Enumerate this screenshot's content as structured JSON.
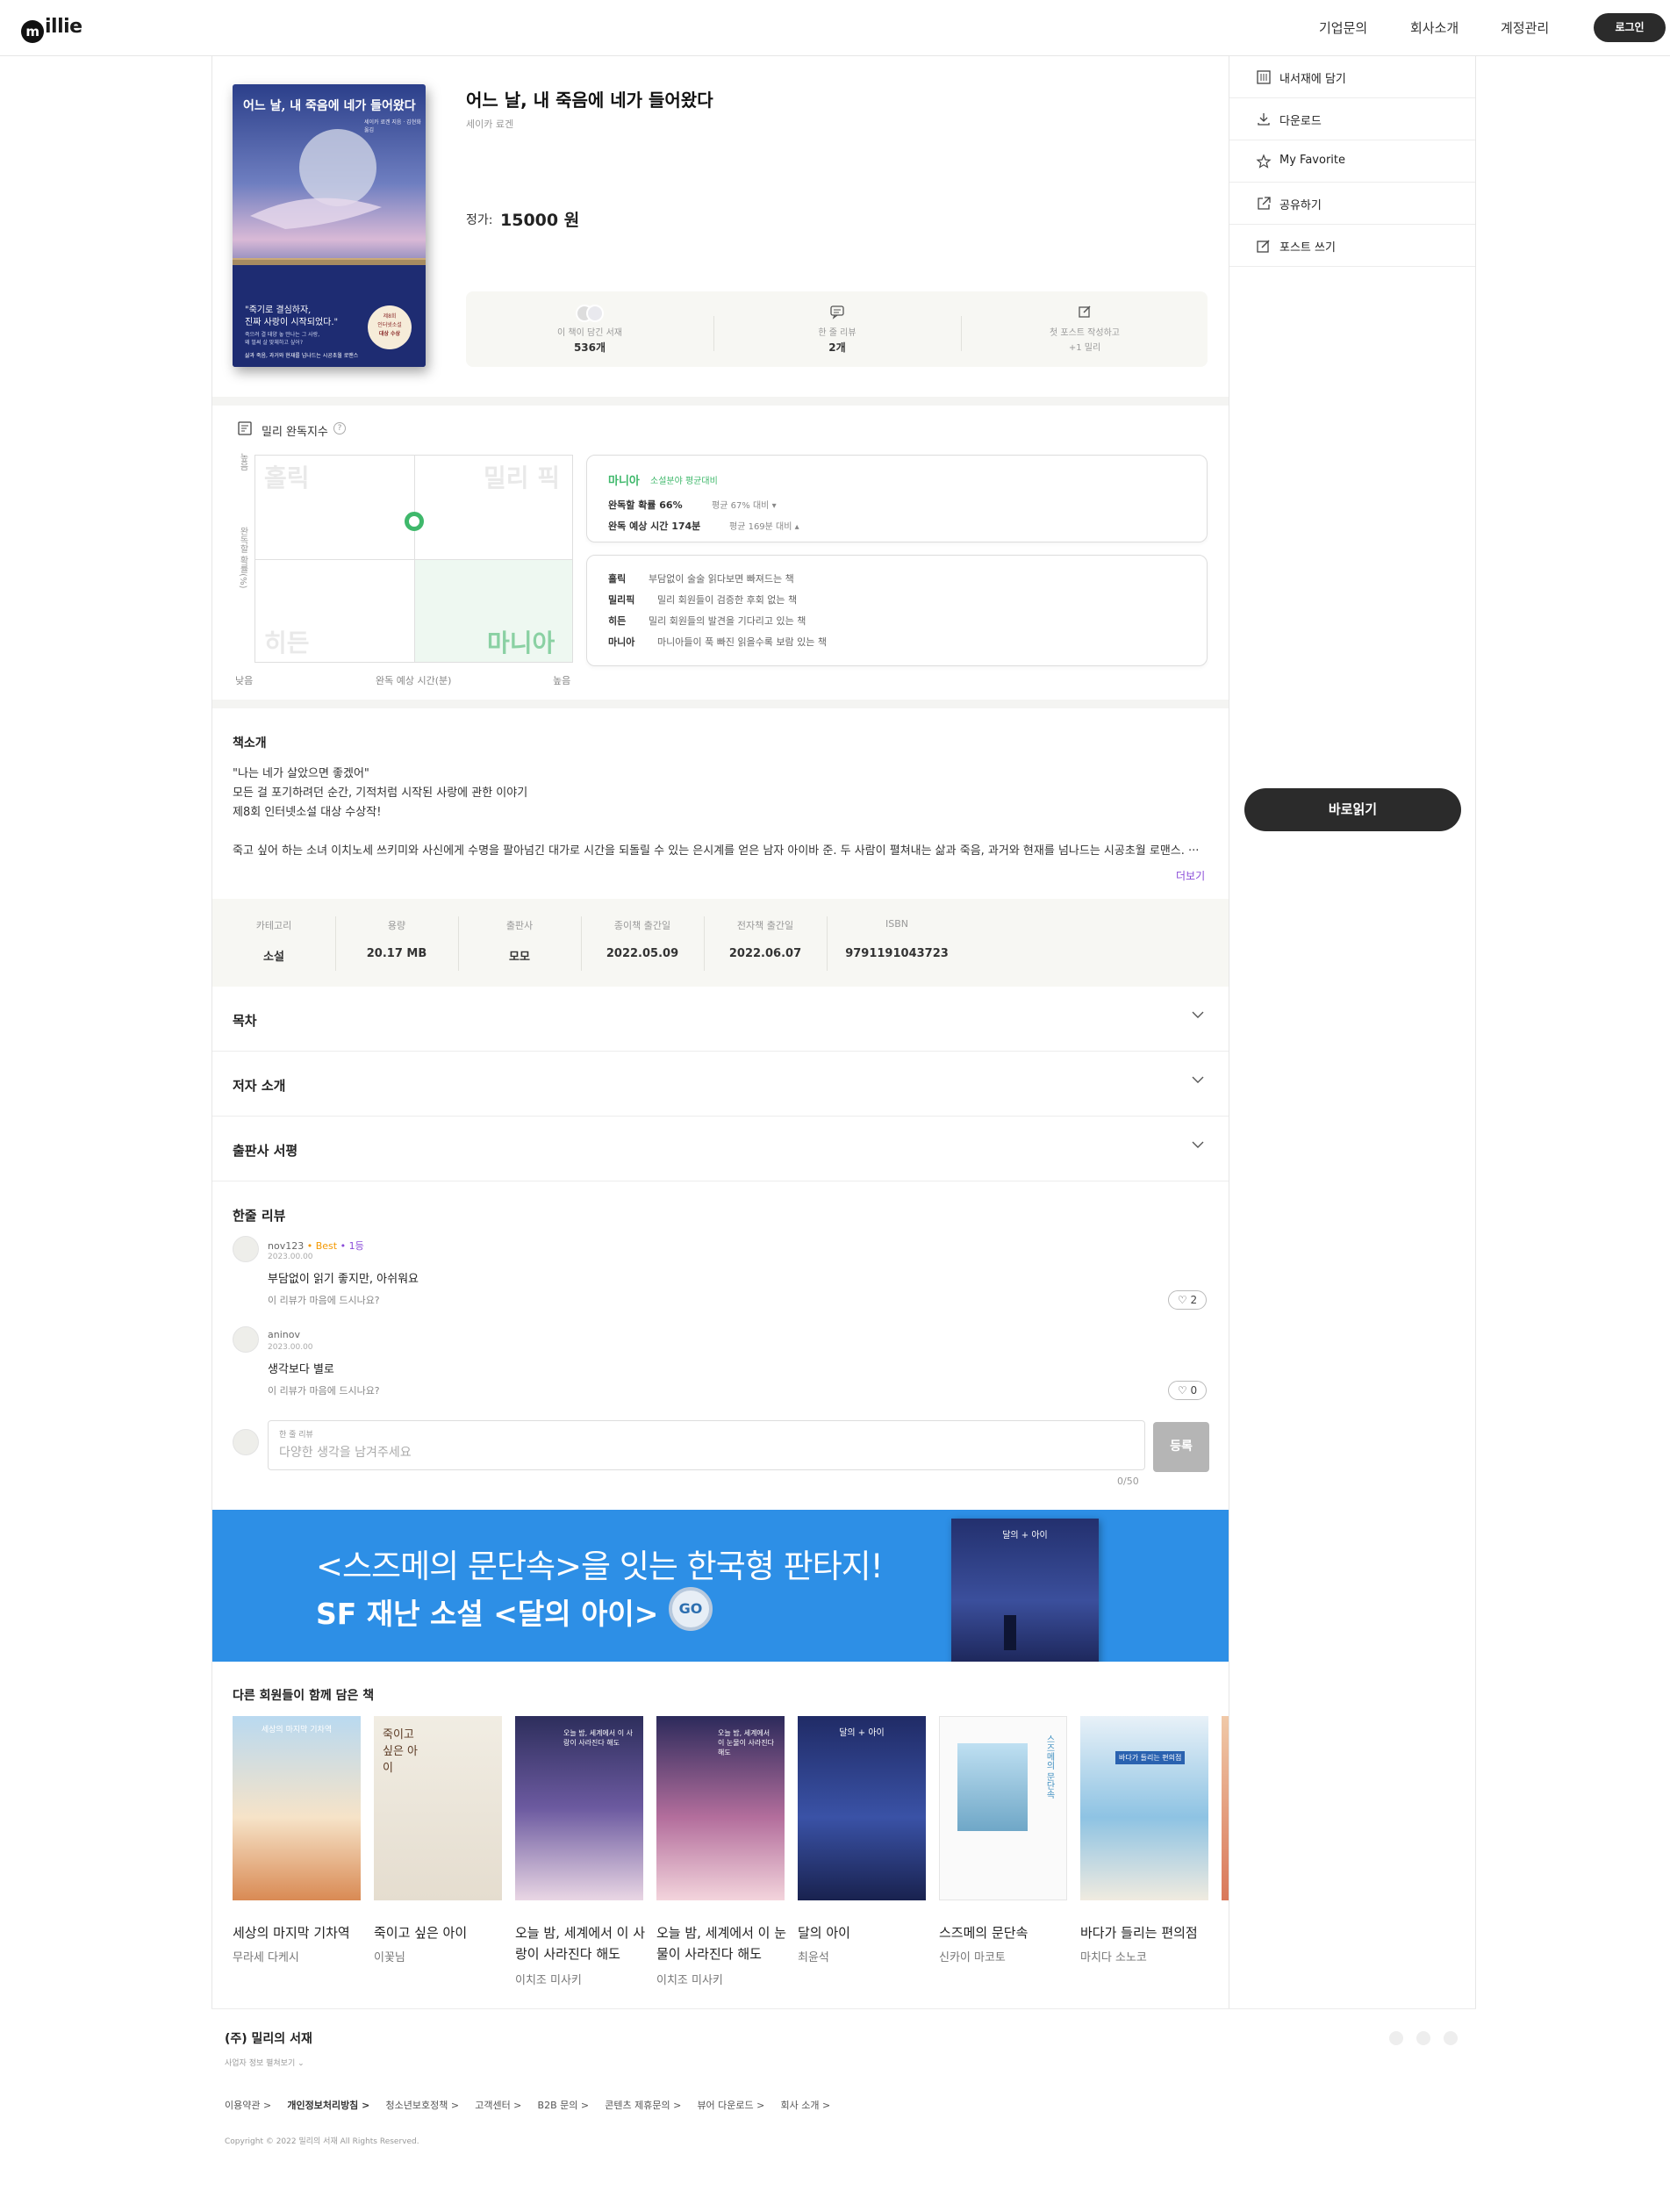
{
  "header": {
    "logo": "illie",
    "nav": [
      "기업문의",
      "회사소개",
      "계정관리"
    ],
    "login": "로그인"
  },
  "book": {
    "title": "어느 날, 내 죽음에 네가 들어왔다",
    "author": "세이카 료겐",
    "price_label": "정가:",
    "price": "15000 원",
    "cover": {
      "title": "어느 날, 내 죽음에 네가 들어왔다",
      "credits": "세이카 료겐 지음 · 김현화 옮김",
      "quote1": "\"죽기로 결심하자,",
      "quote2": "진짜 사랑이 시작되었다.\"",
      "blurb1": "죽으려 결 태양 놓 만나는 그 사랑,",
      "blurb2": "왜 벌써 살 맞체하고 싶어?",
      "badge1": "제8회",
      "badge2": "인터넷소설",
      "badge3": "대상 수상",
      "bottom": "삶과 죽음, 과거와 현재를 넘나드는 시공초월 로맨스"
    }
  },
  "stats": [
    {
      "label": "이 책이 담긴 서재",
      "value": "536개"
    },
    {
      "label": "한 줄 리뷰",
      "value": "2개"
    },
    {
      "label": "첫 포스트 작성하고",
      "value": "+1 밀리"
    }
  ],
  "sidebar": {
    "items": [
      "내서재에 담기",
      "다운로드",
      "My Favorite",
      "공유하기",
      "포스트 쓰기"
    ],
    "read_button": "바로읽기"
  },
  "millie_index": {
    "title": "밀리 완독지수",
    "y_top": "높음",
    "y_label": "완독할 확률(%)",
    "x_left": "낮음",
    "x_label": "완독 예상 시간(분)",
    "x_right": "높음",
    "quadrants": [
      "홀릭",
      "밀리 픽",
      "히든",
      "마니아"
    ],
    "point": {
      "x_fraction": 0.5,
      "y_fraction": 0.32
    },
    "summary": {
      "category": "마니아",
      "compare": "소설분야 평균대비",
      "rate_label": "완독할 확률 66%",
      "rate_avg": "평균 67% 대비",
      "time_label": "완독 예상 시간 174분",
      "time_avg": "평균 169분 대비"
    },
    "legend": [
      {
        "name": "홀릭",
        "desc": "부담없이 술술 읽다보면 빠져드는 책"
      },
      {
        "name": "밀리픽",
        "desc": "밀리 회원들이 검증한 후회 없는 책"
      },
      {
        "name": "히든",
        "desc": "밀리 회원들의 발견을 기다리고 있는 책"
      },
      {
        "name": "마니아",
        "desc": "마니아들이 푹 빠진 읽을수록 보람 있는 책"
      }
    ]
  },
  "intro": {
    "title": "책소개",
    "lines": [
      "\"나는 네가 살았으면 좋겠어\"",
      "모든 걸 포기하려던 순간, 기적처럼 시작된 사랑에 관한 이야기",
      "제8회 인터넷소설 대상 수상작!",
      "",
      "죽고 싶어 하는 소녀 이치노세 쓰키미와 사신에게 수명을 팔아넘긴 대가로 시간을 되돌릴 수 있는 은시계를 얻은 남자 아이바 준. 두 사람이 펼쳐내는 삶과 죽음, 과거와 현재를 넘나드는 시공초월 로맨스. ···"
    ],
    "more": "더보기"
  },
  "info": [
    {
      "k": "카테고리",
      "v": "소설"
    },
    {
      "k": "용량",
      "v": "20.17 MB"
    },
    {
      "k": "출판사",
      "v": "모모"
    },
    {
      "k": "종이책 출간일",
      "v": "2022.05.09"
    },
    {
      "k": "전자책 출간일",
      "v": "2022.06.07"
    },
    {
      "k": "ISBN",
      "v": "9791191043723"
    }
  ],
  "accordions": [
    "목차",
    "저자 소개",
    "출판사 서평"
  ],
  "reviews": {
    "title": "한줄 리뷰",
    "items": [
      {
        "user": "nov123",
        "badge1": "Best",
        "badge2": "1등",
        "date": "2023.00.00",
        "text": "부담없이 읽기 좋지만, 아쉬워요",
        "ask": "이 리뷰가 마음에 드시나요?",
        "likes": "2"
      },
      {
        "user": "aninov",
        "date": "2023.00.00",
        "text": "생각보다 별로",
        "ask": "이 리뷰가 마음에 드시나요?",
        "likes": "0"
      }
    ],
    "input_label": "한 줄 리뷰",
    "placeholder": "다양한 생각을 남겨주세요",
    "submit": "등록",
    "counter": "0/50"
  },
  "banner": {
    "line1": "<스즈메의 문단속>을 잇는 한국형 판타지!",
    "line2": "SF 재난 소설 <달의 아이>",
    "go": "GO",
    "book_title": "달의 + 아이"
  },
  "recommend": {
    "title": "다른 회원들이 함께 담은 책",
    "books": [
      {
        "name": "세상의 마지막 기차역",
        "author": "무라세 다케시",
        "cover_text": "세상의 마지막 기차역"
      },
      {
        "name": "죽이고 싶은 아이",
        "author": "이꽃님",
        "cover_text": "죽이고 싶은 아이"
      },
      {
        "name": "오늘 밤, 세계에서 이 사랑이 사라진다 해도",
        "author": "이치조 미사키",
        "cover_text": "오늘 밤, 세계에서 이 사랑이 사라진다 해도"
      },
      {
        "name": "오늘 밤, 세계에서 이 눈물이 사라진다 해도",
        "author": "이치조 미사키",
        "cover_text": "오늘 밤, 세계에서 이 눈물이 사라진다 해도"
      },
      {
        "name": "달의 아이",
        "author": "최윤석",
        "cover_text": "달의 + 아이"
      },
      {
        "name": "스즈메의 문단속",
        "author": "신카이 마코토",
        "cover_text": "스즈메의 문단속"
      },
      {
        "name": "바다가 들리는 편의점",
        "author": "마치다 소노코",
        "cover_text": "바다가 들리는 편의점"
      }
    ]
  },
  "footer": {
    "company": "(주) 밀리의 서재",
    "biz_info": "사업자 정보 펼쳐보기",
    "links": [
      "이용약관 >",
      "개인정보처리방침 >",
      "청소년보호정책 >",
      "고객센터 >",
      "B2B 문의 >",
      "콘텐츠 제휴문의 >",
      "뷰어 다운로드 >",
      "회사 소개 >"
    ],
    "copyright": "Copyright © 2022 밀리의 서재 All Rights Reserved."
  },
  "colors": {
    "accent_green": "#3fb86b",
    "banner_blue": "#2d8fe6",
    "dark": "#2b2b2b",
    "best_orange": "#f39800",
    "rank_purple": "#8a4bd8"
  }
}
